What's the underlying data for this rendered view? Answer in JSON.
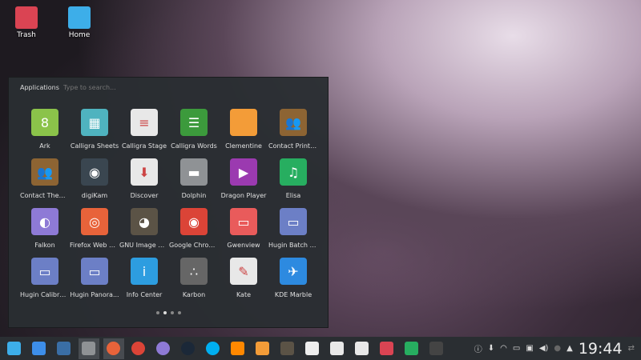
{
  "desktop": [
    {
      "label": "Trash",
      "icon": "trash-icon",
      "color": "#da4453"
    },
    {
      "label": "Home",
      "icon": "home-folder-icon",
      "color": "#3daee9"
    }
  ],
  "launcher": {
    "title": "Applications",
    "search_placeholder": "Type to search...",
    "page": 2,
    "pages": 4,
    "apps": [
      {
        "label": "Ark",
        "color": "#8bc34a",
        "glyph": "8"
      },
      {
        "label": "Calligra Sheets",
        "color": "#4fb3bf",
        "glyph": "▦"
      },
      {
        "label": "Calligra Stage",
        "color": "#e8e8e8",
        "glyph": "≡"
      },
      {
        "label": "Calligra Words",
        "color": "#3c9a3c",
        "glyph": "☰"
      },
      {
        "label": "Clementine",
        "color": "#f39c38",
        "glyph": ""
      },
      {
        "label": "Contact Print ...",
        "color": "#8d6433",
        "glyph": "👥"
      },
      {
        "label": "Contact Them...",
        "color": "#8d6433",
        "glyph": "👥"
      },
      {
        "label": "digiKam",
        "color": "#3a4650",
        "glyph": "◉"
      },
      {
        "label": "Discover",
        "color": "#e8e8e8",
        "glyph": "⬇"
      },
      {
        "label": "Dolphin",
        "color": "#8f9295",
        "glyph": "▬"
      },
      {
        "label": "Dragon Player",
        "color": "#9b3ab0",
        "glyph": "▶"
      },
      {
        "label": "Elisa",
        "color": "#27ae60",
        "glyph": "♫"
      },
      {
        "label": "Falkon",
        "color": "#8e7ad6",
        "glyph": "◐"
      },
      {
        "label": "Firefox Web B...",
        "color": "#e8633a",
        "glyph": "◎"
      },
      {
        "label": "GNU Image M...",
        "color": "#5b5346",
        "glyph": "◕"
      },
      {
        "label": "Google Chrome",
        "color": "#db4437",
        "glyph": "◉"
      },
      {
        "label": "Gwenview",
        "color": "#e95b5b",
        "glyph": "▭"
      },
      {
        "label": "Hugin Batch P...",
        "color": "#6c7fc6",
        "glyph": "▭"
      },
      {
        "label": "Hugin Calibrat...",
        "color": "#6c7fc6",
        "glyph": "▭"
      },
      {
        "label": "Hugin Panora...",
        "color": "#6c7fc6",
        "glyph": "▭"
      },
      {
        "label": "Info Center",
        "color": "#2d9de0",
        "glyph": "i"
      },
      {
        "label": "Karbon",
        "color": "#666",
        "glyph": "∴"
      },
      {
        "label": "Kate",
        "color": "#e8e8e8",
        "glyph": "✎"
      },
      {
        "label": "KDE Marble",
        "color": "#2d8ae0",
        "glyph": "✈"
      }
    ]
  },
  "taskbar": {
    "items": [
      {
        "name": "application-launcher",
        "color": "#3daee9"
      },
      {
        "name": "show-desktop",
        "color": "#3d8ee9"
      },
      {
        "name": "screenshot",
        "color": "#3a6ea5"
      },
      {
        "name": "dolphin",
        "color": "#8f9295",
        "active": true
      },
      {
        "name": "firefox",
        "color": "#e8633a",
        "active": true
      },
      {
        "name": "chrome",
        "color": "#db4437"
      },
      {
        "name": "falkon",
        "color": "#8e7ad6"
      },
      {
        "name": "steam",
        "color": "#1b2838"
      },
      {
        "name": "skype",
        "color": "#00aff0"
      },
      {
        "name": "vlc",
        "color": "#ff8800"
      },
      {
        "name": "clementine",
        "color": "#f39c38"
      },
      {
        "name": "gimp",
        "color": "#5b5346"
      },
      {
        "name": "text-editor",
        "color": "#eeeeee"
      },
      {
        "name": "calligra",
        "color": "#e8e8e8"
      },
      {
        "name": "okular",
        "color": "#e8e8e8"
      },
      {
        "name": "kdenlive",
        "color": "#da4453"
      },
      {
        "name": "system-monitor",
        "color": "#27ae60"
      },
      {
        "name": "terminal",
        "color": "#444"
      }
    ]
  },
  "tray": {
    "clock": "19:44"
  }
}
